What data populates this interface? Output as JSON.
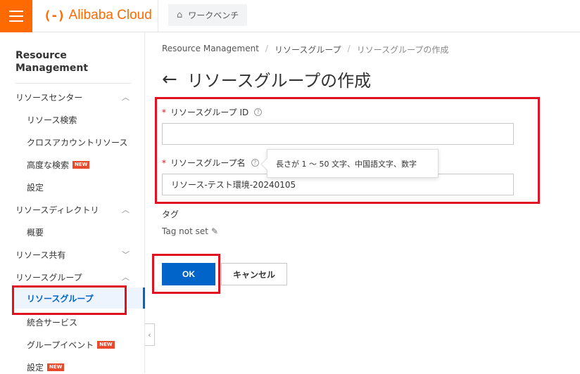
{
  "header": {
    "menu_icon": "hamburger-icon",
    "logo_mark": "(-)",
    "logo_text": "Alibaba Cloud",
    "workbench_label": "ワークベンチ",
    "brand_color": "#ff6a00"
  },
  "sidebar": {
    "title": "Resource Management",
    "groups": [
      {
        "label": "リソースセンター",
        "chevron": "up"
      },
      {
        "label": "リソースディレクトリ",
        "chevron": "up"
      },
      {
        "label": "リソース共有",
        "chevron": "down"
      },
      {
        "label": "リソースグループ",
        "chevron": "up"
      }
    ],
    "items": [
      {
        "label": "リソース検索"
      },
      {
        "label": "クロスアカウントリソース"
      },
      {
        "label": "高度な検索",
        "badge": "NEW"
      },
      {
        "label": "設定"
      },
      {
        "label": "概要"
      },
      {
        "label": "リソースグループ",
        "active": true
      },
      {
        "label": "統合サービス"
      },
      {
        "label": "グループイベント",
        "badge": "NEW"
      },
      {
        "label": "設定",
        "badge": "NEW"
      }
    ],
    "new_badge": "NEW"
  },
  "breadcrumb": [
    "Resource Management",
    "リソースグループ",
    "リソースグループの作成"
  ],
  "page": {
    "title": "リソースグループの作成"
  },
  "form": {
    "required_mark": "*",
    "group_id_label": "リソースグループ ID",
    "group_id_value": "",
    "group_name_label": "リソースグループ名",
    "group_name_value": "リソース-テスト環境-20240105",
    "tooltip": "長さが 1 ～ 50 文字、中国語文字、数字",
    "tag_label": "タグ",
    "tag_value": "Tag not set",
    "ok_label": "OK",
    "cancel_label": "キャンセル"
  },
  "colors": {
    "primary": "#0064c8",
    "highlight_box": "#e0121f",
    "badge": "#e84a2e"
  }
}
